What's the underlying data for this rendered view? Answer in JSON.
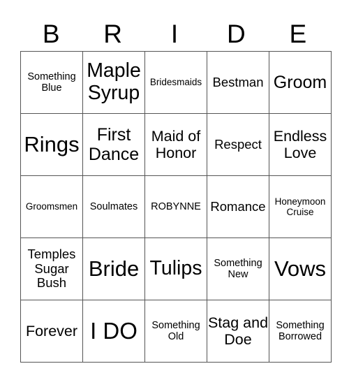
{
  "header": [
    "B",
    "R",
    "I",
    "D",
    "E"
  ],
  "rows": [
    [
      "Something Blue",
      "Maple Syrup",
      "Bridesmaids",
      "Bestman",
      "Groom"
    ],
    [
      "Rings",
      "First Dance",
      "Maid of Honor",
      "Respect",
      "Endless Love"
    ],
    [
      "Groomsmen",
      "Soulmates",
      "ROBYNNE",
      "Romance",
      "Honeymoon Cruise"
    ],
    [
      "Temples Sugar Bush",
      "Bride",
      "Tulips",
      "Something New",
      "Vows"
    ],
    [
      "Forever",
      "I DO",
      "Something Old",
      "Stag and Doe",
      "Something Borrowed"
    ]
  ]
}
